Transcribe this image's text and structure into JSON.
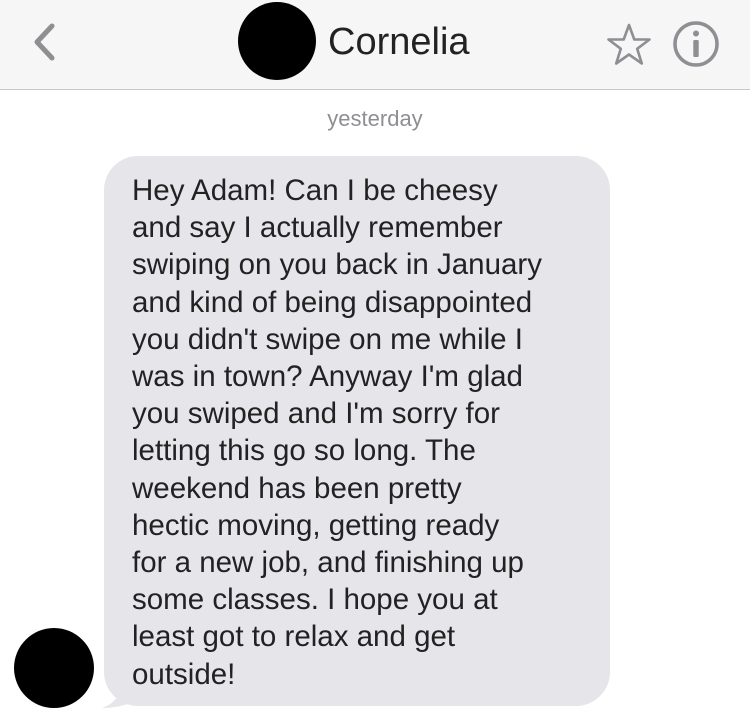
{
  "header": {
    "contact_name": "Cornelia",
    "back_icon": "chevron-left-icon",
    "favorite_icon": "star-outline-icon",
    "info_icon": "info-circle-icon"
  },
  "conversation": {
    "timestamp": "yesterday",
    "messages": [
      {
        "sender": "contact",
        "text": "Hey Adam! Can I be cheesy\nand say I actually remember\nswiping on you back in January\nand kind of being disappointed\nyou didn't swipe on me while I\nwas in town? Anyway I'm glad\nyou swiped and I'm sorry for\nletting this go so long. The\nweekend has been pretty\nhectic moving, getting ready\nfor a new job, and finishing up\nsome classes. I hope you at\nleast got to relax and get\noutside!"
      }
    ]
  },
  "colors": {
    "header_bg": "#f6f6f6",
    "incoming_bubble": "#e5e5ea",
    "icon_gray": "#8e8e93",
    "text": "#222222"
  }
}
